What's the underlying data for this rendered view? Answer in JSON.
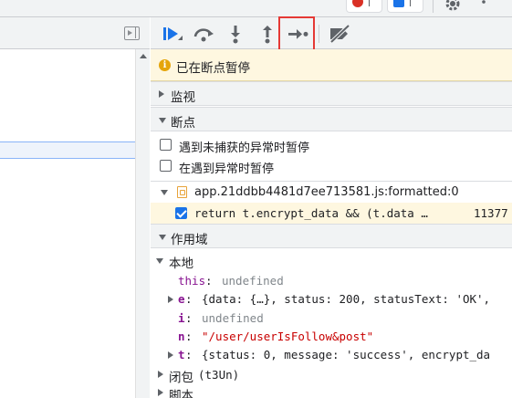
{
  "toolbar": {
    "buttons": [
      {
        "name": "resume-icon",
        "color": "#1a73e8"
      },
      {
        "name": "step-over-icon"
      },
      {
        "name": "step-into-icon"
      },
      {
        "name": "step-out-icon"
      },
      {
        "name": "step-icon",
        "highlighted": true
      },
      {
        "name": "deactivate-breakpoints-icon"
      }
    ],
    "highlight_color": "#e53935"
  },
  "paused": {
    "text": "已在断点暂停"
  },
  "sections": {
    "watch": "监视",
    "breakpoints": "断点",
    "scope": "作用域"
  },
  "breakpoint_options": {
    "pause_uncaught": "遇到未捕获的异常时暂停",
    "pause_caught": "在遇到异常时暂停"
  },
  "breakpoint_file": {
    "name": "app.21ddbb4481d7ee713581.js:formatted:0",
    "line_code": "return t.encrypt_data && (t.data …",
    "line_number": "11377"
  },
  "scope": {
    "local_label": "本地",
    "entries": [
      {
        "key": "this",
        "sep": ": ",
        "value": "undefined"
      },
      {
        "key": "e",
        "sep": ": ",
        "value": "{data: {…}, status: 200, statusText: 'OK',"
      },
      {
        "key": "i",
        "sep": ": ",
        "value": "undefined"
      },
      {
        "key": "n",
        "sep": ": ",
        "value": "\"/user/userIsFollow&post\""
      },
      {
        "key": "t",
        "sep": ": ",
        "value": "{status: 0, message: 'success', encrypt_da"
      }
    ],
    "closure_label": "闭包",
    "closure_name": "(t3Un)",
    "script_label": "脚本"
  }
}
